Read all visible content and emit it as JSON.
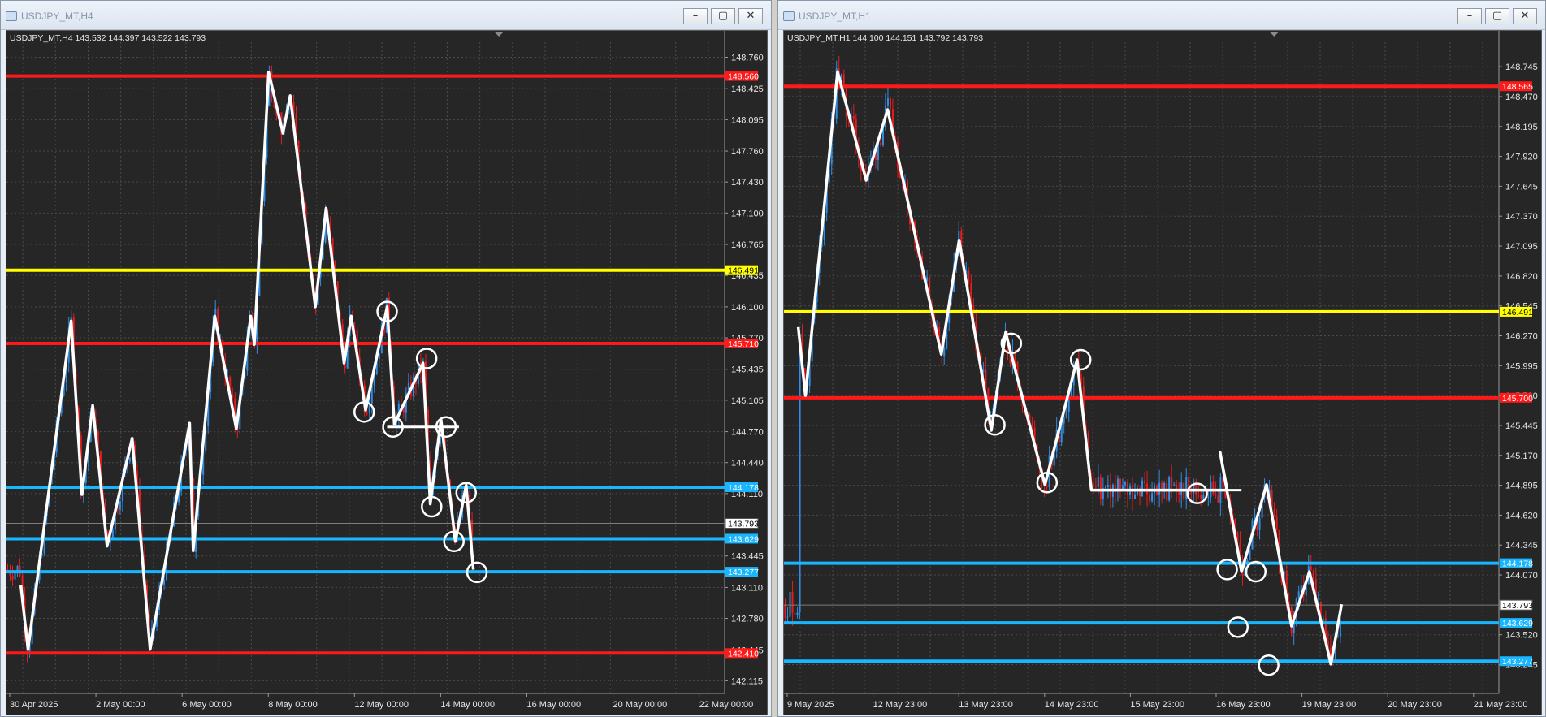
{
  "charts": [
    {
      "window_title": "USDJPY_MT,H4",
      "info": "USDJPY_MT,H4  143.532 144.397 143.522 143.793",
      "price_min": 141.98,
      "price_max": 148.92,
      "price_labels": [
        "148.760",
        "148.425",
        "148.095",
        "147.760",
        "147.430",
        "147.100",
        "146.765",
        "146.435",
        "146.100",
        "145.770",
        "145.435",
        "145.105",
        "144.770",
        "144.440",
        "144.110",
        "143.445",
        "143.110",
        "142.780",
        "142.445",
        "142.115"
      ],
      "time_labels": [
        "30 Apr 2025",
        "2 May 00:00",
        "6 May 00:00",
        "8 May 00:00",
        "12 May 00:00",
        "14 May 00:00",
        "16 May 00:00",
        "20 May 00:00",
        "22 May 00:00"
      ],
      "current_price": "143.793",
      "lines": [
        {
          "price": 148.56,
          "color": "#ff1a1a",
          "label": "148.560"
        },
        {
          "price": 146.491,
          "color": "#ffff00",
          "label": "146.491"
        },
        {
          "price": 145.71,
          "color": "#ff1a1a",
          "label": "145.710"
        },
        {
          "price": 144.178,
          "color": "#1ab5ff",
          "label": "144.178"
        },
        {
          "price": 143.629,
          "color": "#1ab5ff",
          "label": "143.629"
        },
        {
          "price": 143.277,
          "color": "#1ab5ff",
          "label": "143.277"
        },
        {
          "price": 142.41,
          "color": "#ff1a1a",
          "label": "142.410"
        }
      ],
      "zigzag": [
        [
          0.02,
          143.13
        ],
        [
          0.03,
          142.45
        ],
        [
          0.09,
          145.95
        ],
        [
          0.105,
          144.1
        ],
        [
          0.12,
          145.05
        ],
        [
          0.14,
          143.55
        ],
        [
          0.175,
          144.7
        ],
        [
          0.2,
          142.45
        ],
        [
          0.255,
          144.86
        ],
        [
          0.26,
          143.5
        ],
        [
          0.29,
          146.0
        ],
        [
          0.32,
          144.8
        ],
        [
          0.34,
          146.0
        ],
        [
          0.345,
          145.7
        ],
        [
          0.365,
          148.6
        ],
        [
          0.385,
          147.95
        ],
        [
          0.395,
          148.35
        ],
        [
          0.43,
          146.1
        ],
        [
          0.445,
          147.15
        ],
        [
          0.47,
          145.5
        ],
        [
          0.48,
          146.0
        ],
        [
          0.5,
          145.0
        ],
        [
          0.53,
          146.1
        ],
        [
          0.54,
          144.85
        ],
        [
          0.58,
          145.5
        ],
        [
          0.59,
          144.0
        ],
        [
          0.605,
          144.9
        ],
        [
          0.625,
          143.6
        ],
        [
          0.64,
          144.2
        ],
        [
          0.65,
          143.3
        ]
      ],
      "hline": [
        0.53,
        0.63,
        144.82
      ],
      "circles": [
        [
          0.498,
          144.98
        ],
        [
          0.538,
          144.82
        ],
        [
          0.585,
          145.55
        ],
        [
          0.612,
          144.82
        ],
        [
          0.592,
          143.97
        ],
        [
          0.64,
          144.12
        ],
        [
          0.623,
          143.6
        ],
        [
          0.655,
          143.27
        ],
        [
          0.53,
          146.05
        ]
      ]
    },
    {
      "window_title": "USDJPY_MT,H1",
      "info": "USDJPY_MT,H1  144.100 144.151 143.792 143.793",
      "price_min": 142.98,
      "price_max": 148.97,
      "price_labels": [
        "148.745",
        "148.470",
        "148.195",
        "147.920",
        "147.645",
        "147.370",
        "147.095",
        "146.820",
        "146.545",
        "146.270",
        "145.995",
        "145.720",
        "145.445",
        "145.170",
        "144.895",
        "144.620",
        "144.345",
        "144.070",
        "143.520",
        "143.245"
      ],
      "time_labels": [
        "9 May 2025",
        "12 May 23:00",
        "13 May 23:00",
        "14 May 23:00",
        "15 May 23:00",
        "16 May 23:00",
        "19 May 23:00",
        "20 May 23:00",
        "21 May 23:00"
      ],
      "current_price": "143.793",
      "lines": [
        {
          "price": 148.565,
          "color": "#ff1a1a",
          "label": "148.565"
        },
        {
          "price": 146.491,
          "color": "#ffff00",
          "label": "146.491"
        },
        {
          "price": 145.7,
          "color": "#ff1a1a",
          "label": "145.700"
        },
        {
          "price": 144.178,
          "color": "#1ab5ff",
          "label": "144.178"
        },
        {
          "price": 143.629,
          "color": "#1ab5ff",
          "label": "143.629"
        },
        {
          "price": 143.277,
          "color": "#1ab5ff",
          "label": "143.277"
        }
      ],
      "zigzag": [
        [
          0.02,
          146.35
        ],
        [
          0.03,
          145.72
        ],
        [
          0.075,
          148.7
        ],
        [
          0.115,
          147.7
        ],
        [
          0.145,
          148.35
        ],
        [
          0.22,
          146.1
        ],
        [
          0.245,
          147.15
        ],
        [
          0.29,
          145.4
        ],
        [
          0.31,
          146.3
        ],
        [
          0.365,
          144.9
        ],
        [
          0.41,
          146.05
        ],
        [
          0.43,
          144.85
        ],
        [
          0.62,
          144.85
        ],
        [
          0.61,
          145.2
        ],
        [
          0.64,
          144.1
        ],
        [
          0.675,
          144.9
        ],
        [
          0.71,
          143.6
        ],
        [
          0.735,
          144.1
        ],
        [
          0.765,
          143.25
        ],
        [
          0.78,
          143.8
        ]
      ],
      "hline": [
        0.43,
        0.64,
        144.85
      ],
      "circles": [
        [
          0.295,
          145.45
        ],
        [
          0.318,
          146.2
        ],
        [
          0.368,
          144.92
        ],
        [
          0.415,
          146.05
        ],
        [
          0.62,
          144.12
        ],
        [
          0.578,
          144.82
        ],
        [
          0.66,
          144.1
        ],
        [
          0.635,
          143.59
        ],
        [
          0.678,
          143.24
        ]
      ]
    }
  ]
}
